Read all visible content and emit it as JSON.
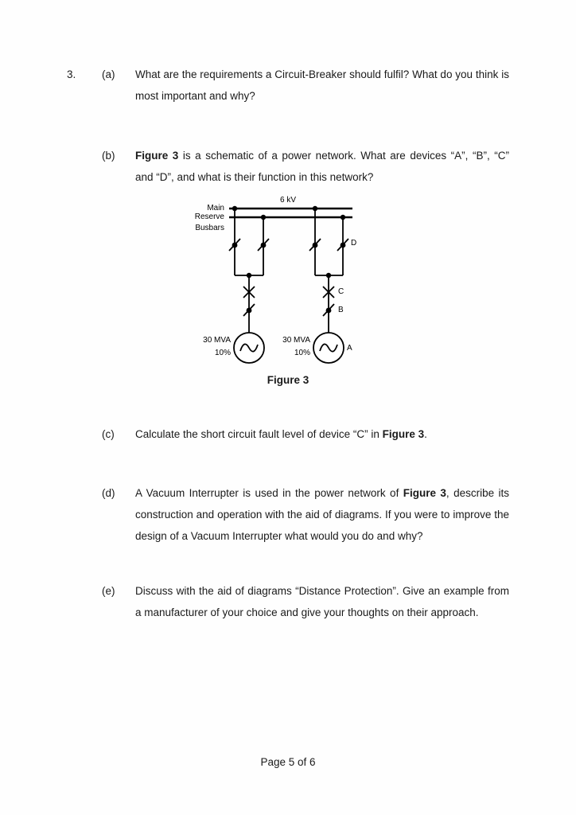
{
  "document": {
    "question_number": "3.",
    "footer": "Page 5 of 6"
  },
  "parts": [
    {
      "label": "(a)",
      "text": "What are the requirements a Circuit-Breaker should fulfil? What do you think is most important and why?"
    },
    {
      "label": "(b)",
      "text_pre": "",
      "bold1": "Figure 3",
      "text": " is a schematic of a power network.  What are devices “A”, “B”, “C” and “D”, and what is their function in this network?"
    },
    {
      "label": "(c)",
      "text_pre": "Calculate the short circuit fault level of device “C” in ",
      "bold1": "Figure 3",
      "text": "."
    },
    {
      "label": "(d)",
      "text_pre": "A Vacuum Interrupter is used in the power network of ",
      "bold1": "Figure 3",
      "text": ", describe its construction and operation with the aid of diagrams.  If you were to improve the design of a Vacuum Interrupter what would you do and why?"
    },
    {
      "label": "(e)",
      "text": "Discuss with the aid of diagrams “Distance Protection”.  Give an example from a manufacturer of your choice and give your thoughts on their approach."
    }
  ],
  "figure": {
    "caption": "Figure 3",
    "voltage_label": "6 kV",
    "busbar_labels": [
      "Main",
      "Reserve",
      "Busbars"
    ],
    "device_labels": {
      "a": "A",
      "b": "B",
      "c": "C",
      "d": "D"
    },
    "generators": [
      {
        "rating": "30 MVA",
        "impedance": "10%"
      },
      {
        "rating": "30 MVA",
        "impedance": "10%"
      }
    ],
    "colors": {
      "line": "#000000",
      "text": "#000000",
      "page": "#ffffff"
    }
  }
}
